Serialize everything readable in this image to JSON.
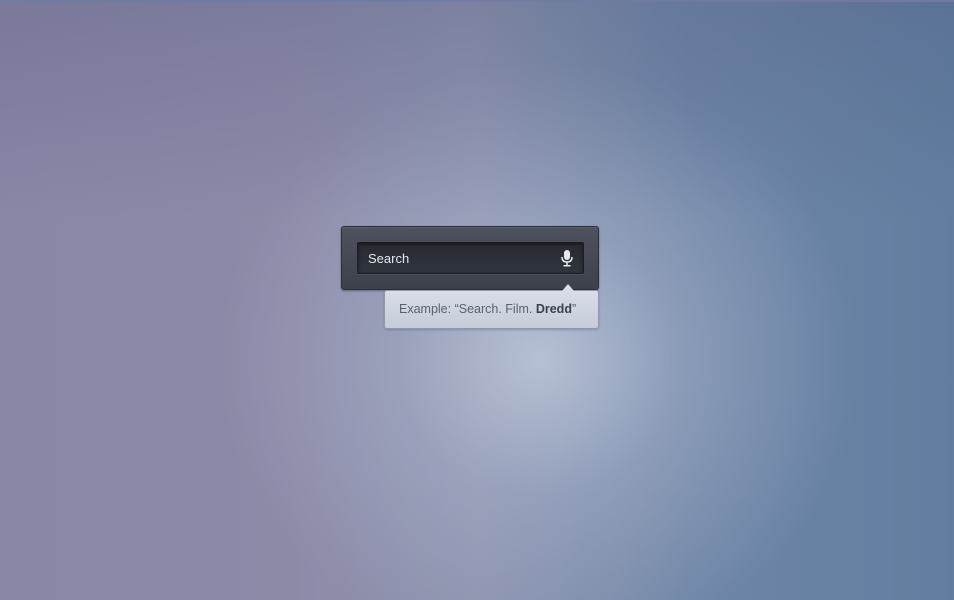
{
  "search": {
    "placeholder": "Search",
    "voice_icon": "microphone-icon"
  },
  "tooltip": {
    "prefix": "Example: “Search. Film. ",
    "highlight": "Dredd",
    "suffix": "”"
  },
  "colors": {
    "panel": "#3d414b",
    "input": "#2b2e35",
    "tooltip": "#d0d5e1",
    "text_light": "#e4e7ee"
  }
}
